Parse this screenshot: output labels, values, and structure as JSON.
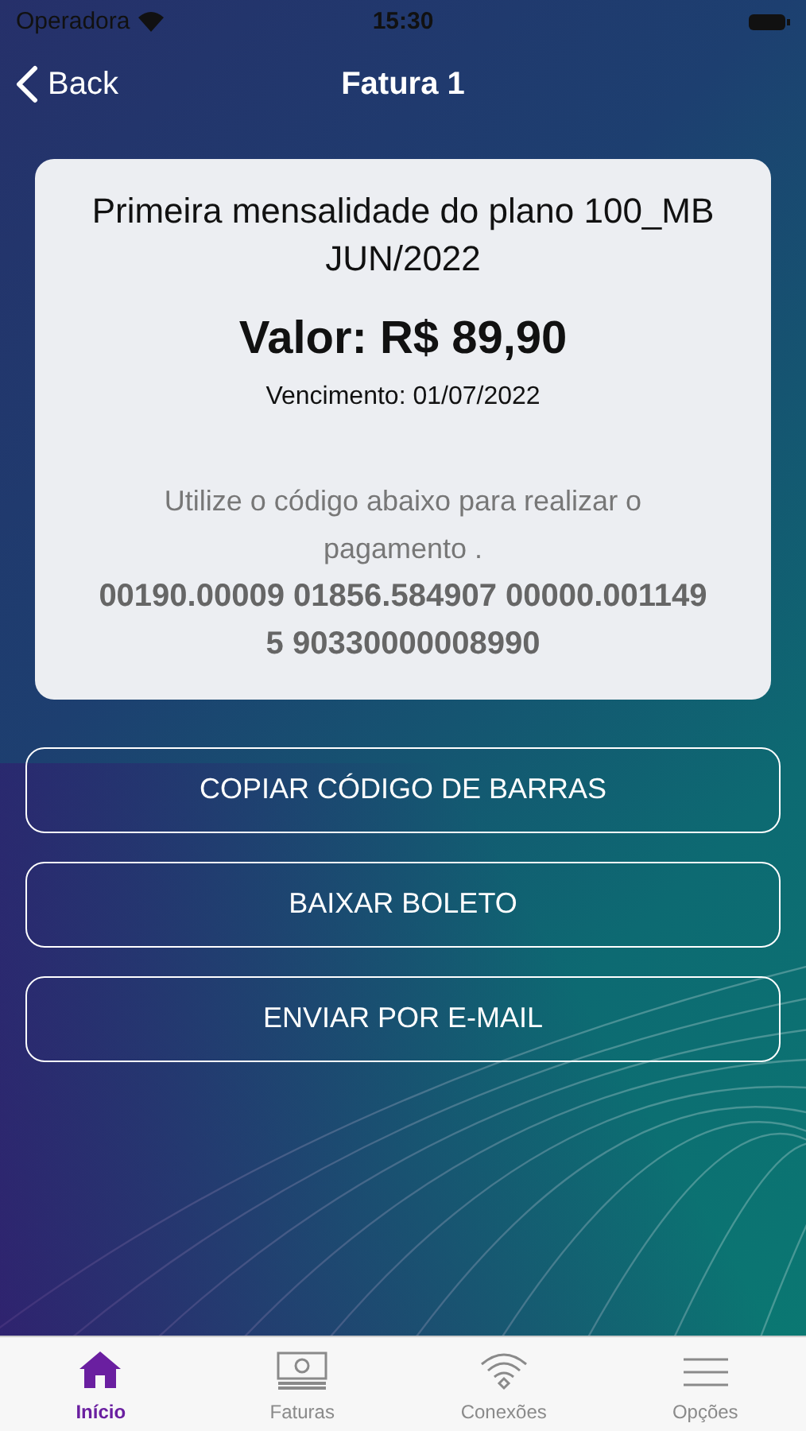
{
  "status_bar": {
    "carrier": "Operadora",
    "time": "15:30"
  },
  "nav": {
    "back": "Back",
    "title": "Fatura 1"
  },
  "card": {
    "description": "Primeira mensalidade do plano 100_MB JUN/2022",
    "amount": "Valor: R$ 89,90",
    "due": "Vencimento: 01/07/2022",
    "instruction": "Utilize o código abaixo para realizar o pagamento .",
    "barcode": "00190.00009 01856.584907 00000.001149 5 90330000008990"
  },
  "buttons": [
    "COPIAR CÓDIGO DE BARRAS",
    "BAIXAR BOLETO",
    "ENVIAR POR E-MAIL"
  ],
  "tabs": [
    {
      "label": "Início",
      "kind": "home",
      "selected": true
    },
    {
      "label": "Faturas",
      "kind": "money",
      "selected": false
    },
    {
      "label": "Conexões",
      "kind": "wifi",
      "selected": false
    },
    {
      "label": "Opções",
      "kind": "menu",
      "selected": false
    }
  ]
}
